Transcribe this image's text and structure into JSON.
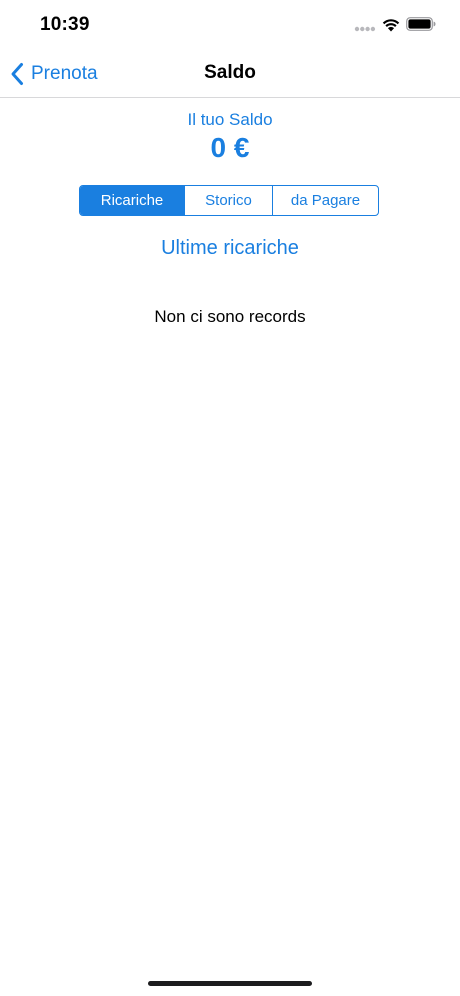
{
  "status_bar": {
    "time": "10:39"
  },
  "nav": {
    "back_label": "Prenota",
    "title": "Saldo"
  },
  "balance": {
    "label": "Il tuo Saldo",
    "value": "0 €"
  },
  "segments": {
    "items": [
      {
        "label": "Ricariche",
        "selected": true
      },
      {
        "label": "Storico",
        "selected": false
      },
      {
        "label": "da Pagare",
        "selected": false
      }
    ]
  },
  "section": {
    "title": "Ultime ricariche"
  },
  "empty_message": "Non ci sono records",
  "colors": {
    "accent": "#1a7fe0",
    "text": "#000000",
    "background": "#ffffff"
  },
  "icons": {
    "signal": "signal-dots-icon",
    "wifi": "wifi-icon",
    "battery": "battery-icon",
    "back": "chevron-left-icon"
  }
}
